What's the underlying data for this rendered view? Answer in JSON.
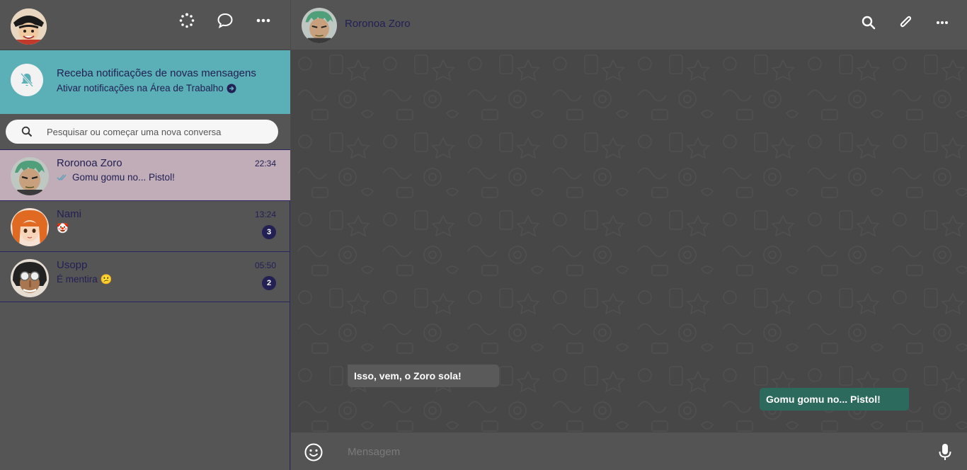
{
  "sidebar": {
    "notification": {
      "title": "Receba notificações de novas mensagens",
      "link": "Ativar notificações na Área de Trabalho"
    },
    "search": {
      "placeholder": "Pesquisar ou começar uma nova conversa"
    },
    "chats": [
      {
        "name": "Roronoa Zoro",
        "time": "22:34",
        "message": "Gomu gomu no... Pistol!",
        "unread": "",
        "active": true
      },
      {
        "name": "Nami",
        "time": "13:24",
        "message": "🤡",
        "unread": "3",
        "active": false
      },
      {
        "name": "Usopp",
        "time": "05:50",
        "message": "É mentira 😕",
        "unread": "2",
        "active": false
      }
    ]
  },
  "conversation": {
    "contact_name": "Roronoa Zoro",
    "messages": [
      {
        "direction": "in",
        "text": "Isso, vem, o Zoro sola!"
      },
      {
        "direction": "out",
        "text": "Gomu gomu no... Pistol!"
      }
    ],
    "input": {
      "placeholder": "Mensagem"
    }
  },
  "colors": {
    "accent": "#222055",
    "notification_bg": "#5bb0b7",
    "active_chat_bg": "#c0adb7",
    "outgoing_bubble": "#2b6a5c",
    "incoming_bubble": "#5a5a5a"
  },
  "icons": [
    "status-icon",
    "new-chat-icon",
    "menu-dots-icon",
    "bell-off-icon",
    "arrow-right-circle-icon",
    "search-icon",
    "double-check-icon",
    "attach-icon",
    "emoji-icon",
    "mic-icon"
  ]
}
